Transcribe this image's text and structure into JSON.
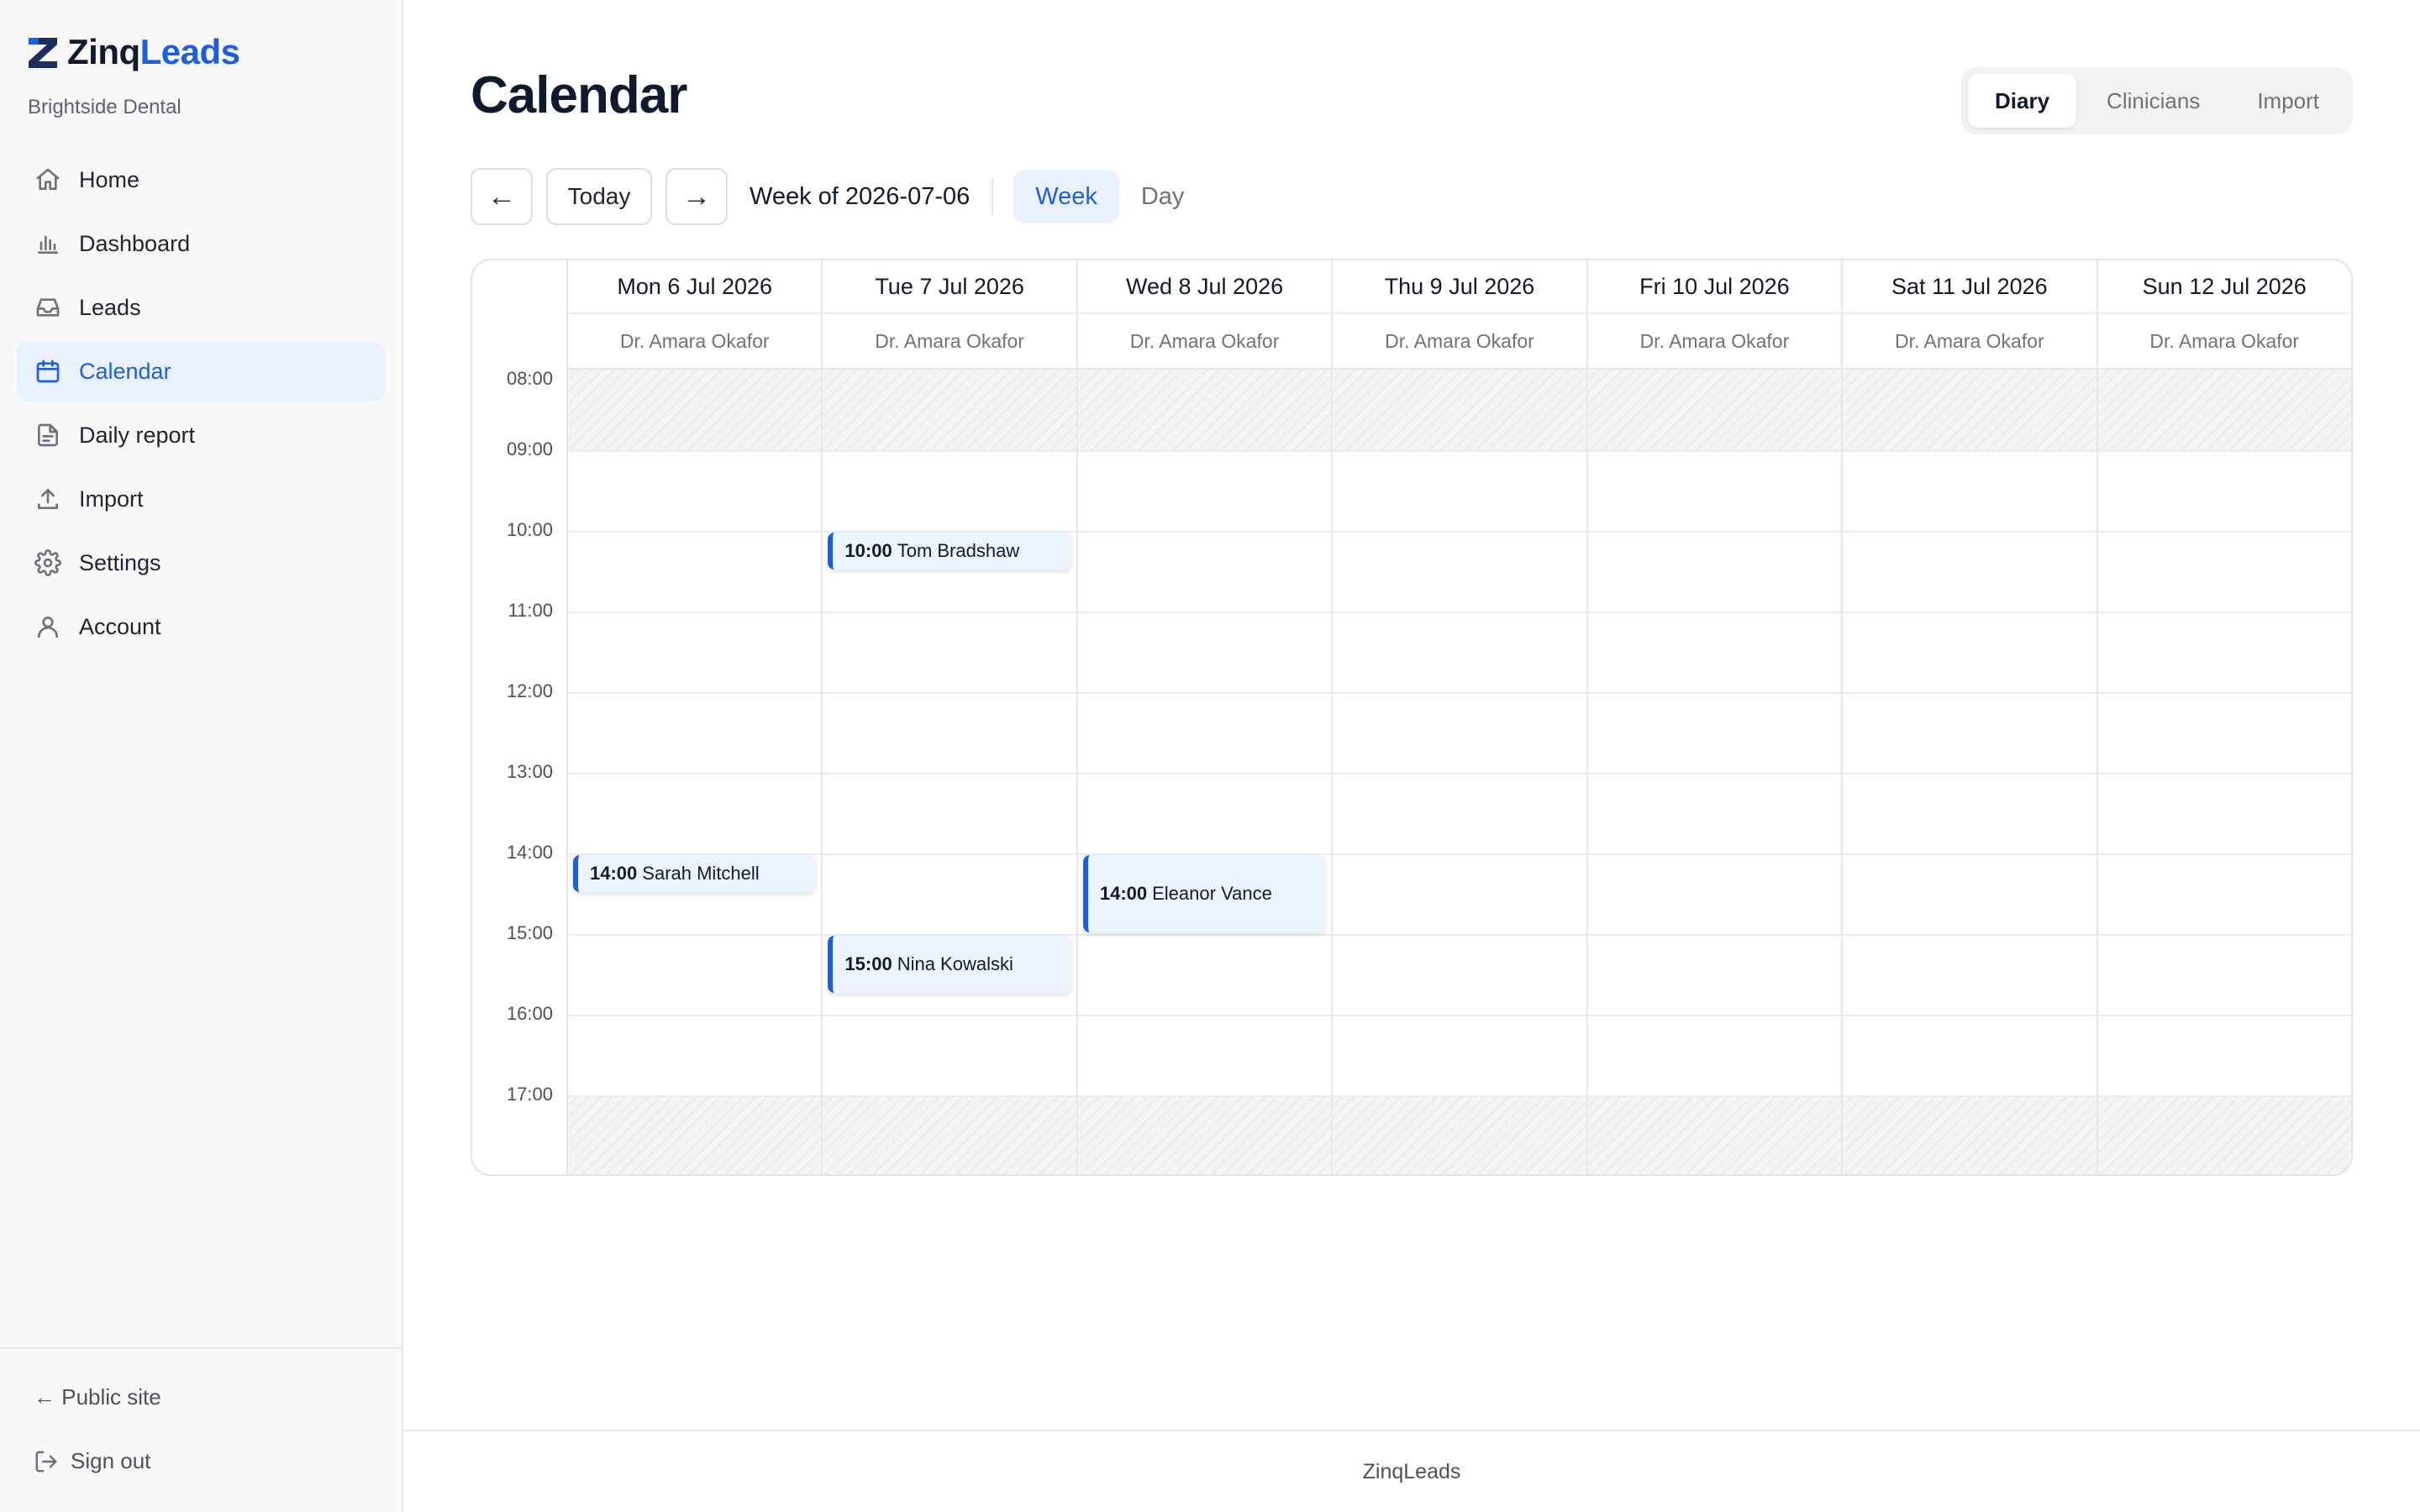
{
  "brand": {
    "name_a": "Zinq",
    "name_b": "Leads",
    "org": "Brightside Dental",
    "accent": "#1d5fe0"
  },
  "nav": {
    "items": [
      {
        "label": "Home",
        "icon": "home-icon"
      },
      {
        "label": "Dashboard",
        "icon": "bar-chart-icon"
      },
      {
        "label": "Leads",
        "icon": "inbox-icon"
      },
      {
        "label": "Calendar",
        "icon": "calendar-icon",
        "active": true
      },
      {
        "label": "Daily report",
        "icon": "file-text-icon"
      },
      {
        "label": "Import",
        "icon": "upload-icon"
      },
      {
        "label": "Settings",
        "icon": "gear-icon"
      },
      {
        "label": "Account",
        "icon": "user-icon"
      }
    ]
  },
  "sidebar_footer": {
    "public_site": "← Public site",
    "sign_out": "Sign out"
  },
  "page": {
    "title": "Calendar"
  },
  "tabs": {
    "diary": "Diary",
    "clinicians": "Clinicians",
    "import": "Import",
    "active": "Diary"
  },
  "toolbar": {
    "prev": "←",
    "today": "Today",
    "next": "→",
    "week_label": "Week of 2026-07-06",
    "view_week": "Week",
    "view_day": "Day",
    "active_view": "Week"
  },
  "calendar": {
    "days": [
      {
        "label": "Mon 6 Jul 2026",
        "clinician": "Dr. Amara Okafor"
      },
      {
        "label": "Tue 7 Jul 2026",
        "clinician": "Dr. Amara Okafor"
      },
      {
        "label": "Wed 8 Jul 2026",
        "clinician": "Dr. Amara Okafor"
      },
      {
        "label": "Thu 9 Jul 2026",
        "clinician": "Dr. Amara Okafor"
      },
      {
        "label": "Fri 10 Jul 2026",
        "clinician": "Dr. Amara Okafor"
      },
      {
        "label": "Sat 11 Jul 2026",
        "clinician": "Dr. Amara Okafor"
      },
      {
        "label": "Sun 12 Jul 2026",
        "clinician": "Dr. Amara Okafor"
      }
    ],
    "hours": [
      "08:00",
      "09:00",
      "10:00",
      "11:00",
      "12:00",
      "13:00",
      "14:00",
      "15:00",
      "16:00",
      "17:00"
    ],
    "closed_hours": [
      "08:00",
      "17:00"
    ],
    "appointments": [
      {
        "day": 1,
        "time": "10:00",
        "name": "Tom Bradshaw",
        "duration_h": 0.5
      },
      {
        "day": 0,
        "time": "14:00",
        "name": "Sarah Mitchell",
        "duration_h": 0.5
      },
      {
        "day": 2,
        "time": "14:00",
        "name": "Eleanor Vance",
        "duration_h": 1
      },
      {
        "day": 1,
        "time": "15:00",
        "name": "Nina Kowalski",
        "duration_h": 0.75
      }
    ]
  },
  "footer": {
    "text": "ZinqLeads"
  }
}
